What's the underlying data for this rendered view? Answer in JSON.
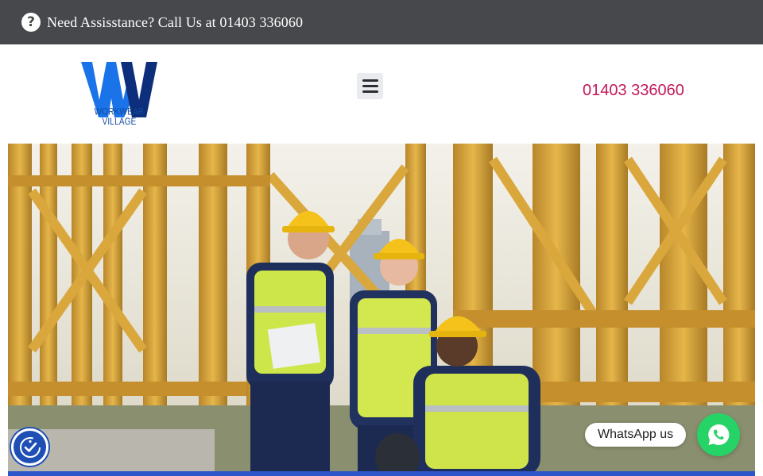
{
  "topbar": {
    "icon": "question-circle-icon",
    "text": "Need Assisstance? Call Us at 01403 336060"
  },
  "header": {
    "logo_alt": "WV",
    "logo_caption": "WORKWEAR VILLAGE",
    "menu_icon": "hamburger-menu-icon",
    "phone": "01403 336060"
  },
  "colors": {
    "topbar_bg": "#46484b",
    "phone_text": "#c2185b",
    "logo_blue": "#1a73e8",
    "logo_navy": "#0d2e7a",
    "whatsapp_green": "#25d366",
    "a11y_blue": "#1f4fb5"
  },
  "hero": {
    "image": "three construction workers in yellow hard hats and hi-vis vests in front of yellow steel scaffolding"
  },
  "widgets": {
    "accessibility_icon": "accessibility-icon",
    "whatsapp_label": "WhatsApp us",
    "whatsapp_icon": "whatsapp-icon"
  }
}
